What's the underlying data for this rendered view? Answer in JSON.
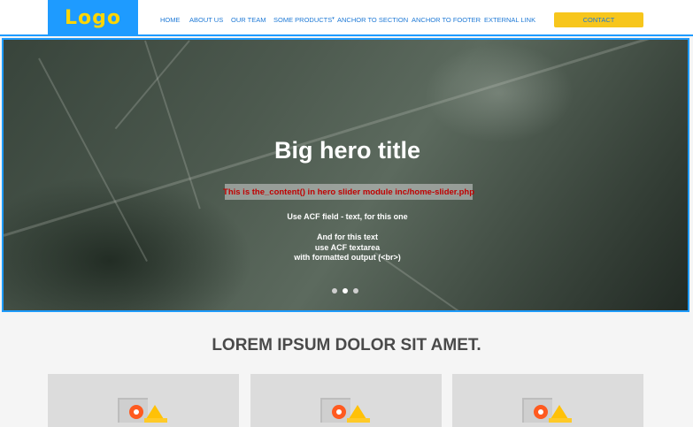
{
  "header": {
    "logo_text": "Logo",
    "nav": [
      "HOME",
      "ABOUT US",
      "OUR TEAM",
      "SOME PRODUCTS",
      "ANCHOR TO SECTION",
      "ANCHOR TO FOOTER",
      "EXTERNAL LINK"
    ],
    "contact_label": "CONTACT"
  },
  "hero": {
    "title": "Big hero title",
    "content_note": "This is the_content() in hero slider module inc/home-slider.php",
    "acf_text": "Use ACF field - text, for this one",
    "acf_textarea": [
      "And for this text",
      "use ACF textarea",
      "with formatted output (<br>)"
    ],
    "slides": 3,
    "active_slide": 2
  },
  "section": {
    "title": "LOREM IPSUM DOLOR SIT AMET."
  },
  "colors": {
    "accent": "#1e9bff",
    "logo_text": "#ffd600",
    "contact_bg": "#f7c61c",
    "note_text": "#c00000"
  }
}
